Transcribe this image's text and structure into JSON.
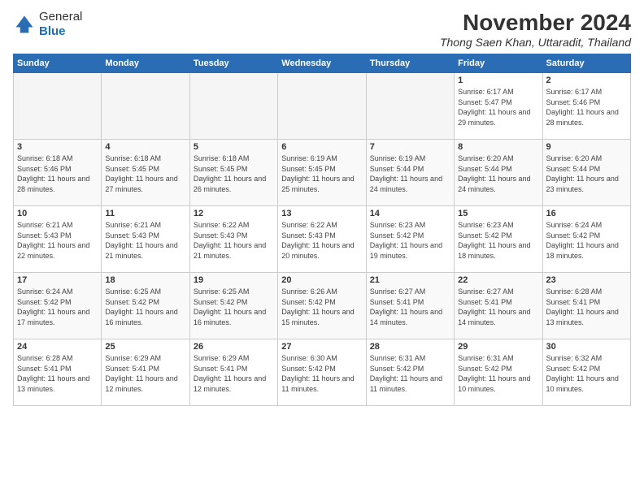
{
  "logo": {
    "general": "General",
    "blue": "Blue"
  },
  "header": {
    "month": "November 2024",
    "location": "Thong Saen Khan, Uttaradit, Thailand"
  },
  "weekdays": [
    "Sunday",
    "Monday",
    "Tuesday",
    "Wednesday",
    "Thursday",
    "Friday",
    "Saturday"
  ],
  "weeks": [
    [
      {
        "day": "",
        "info": ""
      },
      {
        "day": "",
        "info": ""
      },
      {
        "day": "",
        "info": ""
      },
      {
        "day": "",
        "info": ""
      },
      {
        "day": "",
        "info": ""
      },
      {
        "day": "1",
        "info": "Sunrise: 6:17 AM\nSunset: 5:47 PM\nDaylight: 11 hours and 29 minutes."
      },
      {
        "day": "2",
        "info": "Sunrise: 6:17 AM\nSunset: 5:46 PM\nDaylight: 11 hours and 28 minutes."
      }
    ],
    [
      {
        "day": "3",
        "info": "Sunrise: 6:18 AM\nSunset: 5:46 PM\nDaylight: 11 hours and 28 minutes."
      },
      {
        "day": "4",
        "info": "Sunrise: 6:18 AM\nSunset: 5:45 PM\nDaylight: 11 hours and 27 minutes."
      },
      {
        "day": "5",
        "info": "Sunrise: 6:18 AM\nSunset: 5:45 PM\nDaylight: 11 hours and 26 minutes."
      },
      {
        "day": "6",
        "info": "Sunrise: 6:19 AM\nSunset: 5:45 PM\nDaylight: 11 hours and 25 minutes."
      },
      {
        "day": "7",
        "info": "Sunrise: 6:19 AM\nSunset: 5:44 PM\nDaylight: 11 hours and 24 minutes."
      },
      {
        "day": "8",
        "info": "Sunrise: 6:20 AM\nSunset: 5:44 PM\nDaylight: 11 hours and 24 minutes."
      },
      {
        "day": "9",
        "info": "Sunrise: 6:20 AM\nSunset: 5:44 PM\nDaylight: 11 hours and 23 minutes."
      }
    ],
    [
      {
        "day": "10",
        "info": "Sunrise: 6:21 AM\nSunset: 5:43 PM\nDaylight: 11 hours and 22 minutes."
      },
      {
        "day": "11",
        "info": "Sunrise: 6:21 AM\nSunset: 5:43 PM\nDaylight: 11 hours and 21 minutes."
      },
      {
        "day": "12",
        "info": "Sunrise: 6:22 AM\nSunset: 5:43 PM\nDaylight: 11 hours and 21 minutes."
      },
      {
        "day": "13",
        "info": "Sunrise: 6:22 AM\nSunset: 5:43 PM\nDaylight: 11 hours and 20 minutes."
      },
      {
        "day": "14",
        "info": "Sunrise: 6:23 AM\nSunset: 5:42 PM\nDaylight: 11 hours and 19 minutes."
      },
      {
        "day": "15",
        "info": "Sunrise: 6:23 AM\nSunset: 5:42 PM\nDaylight: 11 hours and 18 minutes."
      },
      {
        "day": "16",
        "info": "Sunrise: 6:24 AM\nSunset: 5:42 PM\nDaylight: 11 hours and 18 minutes."
      }
    ],
    [
      {
        "day": "17",
        "info": "Sunrise: 6:24 AM\nSunset: 5:42 PM\nDaylight: 11 hours and 17 minutes."
      },
      {
        "day": "18",
        "info": "Sunrise: 6:25 AM\nSunset: 5:42 PM\nDaylight: 11 hours and 16 minutes."
      },
      {
        "day": "19",
        "info": "Sunrise: 6:25 AM\nSunset: 5:42 PM\nDaylight: 11 hours and 16 minutes."
      },
      {
        "day": "20",
        "info": "Sunrise: 6:26 AM\nSunset: 5:42 PM\nDaylight: 11 hours and 15 minutes."
      },
      {
        "day": "21",
        "info": "Sunrise: 6:27 AM\nSunset: 5:41 PM\nDaylight: 11 hours and 14 minutes."
      },
      {
        "day": "22",
        "info": "Sunrise: 6:27 AM\nSunset: 5:41 PM\nDaylight: 11 hours and 14 minutes."
      },
      {
        "day": "23",
        "info": "Sunrise: 6:28 AM\nSunset: 5:41 PM\nDaylight: 11 hours and 13 minutes."
      }
    ],
    [
      {
        "day": "24",
        "info": "Sunrise: 6:28 AM\nSunset: 5:41 PM\nDaylight: 11 hours and 13 minutes."
      },
      {
        "day": "25",
        "info": "Sunrise: 6:29 AM\nSunset: 5:41 PM\nDaylight: 11 hours and 12 minutes."
      },
      {
        "day": "26",
        "info": "Sunrise: 6:29 AM\nSunset: 5:41 PM\nDaylight: 11 hours and 12 minutes."
      },
      {
        "day": "27",
        "info": "Sunrise: 6:30 AM\nSunset: 5:42 PM\nDaylight: 11 hours and 11 minutes."
      },
      {
        "day": "28",
        "info": "Sunrise: 6:31 AM\nSunset: 5:42 PM\nDaylight: 11 hours and 11 minutes."
      },
      {
        "day": "29",
        "info": "Sunrise: 6:31 AM\nSunset: 5:42 PM\nDaylight: 11 hours and 10 minutes."
      },
      {
        "day": "30",
        "info": "Sunrise: 6:32 AM\nSunset: 5:42 PM\nDaylight: 11 hours and 10 minutes."
      }
    ]
  ]
}
